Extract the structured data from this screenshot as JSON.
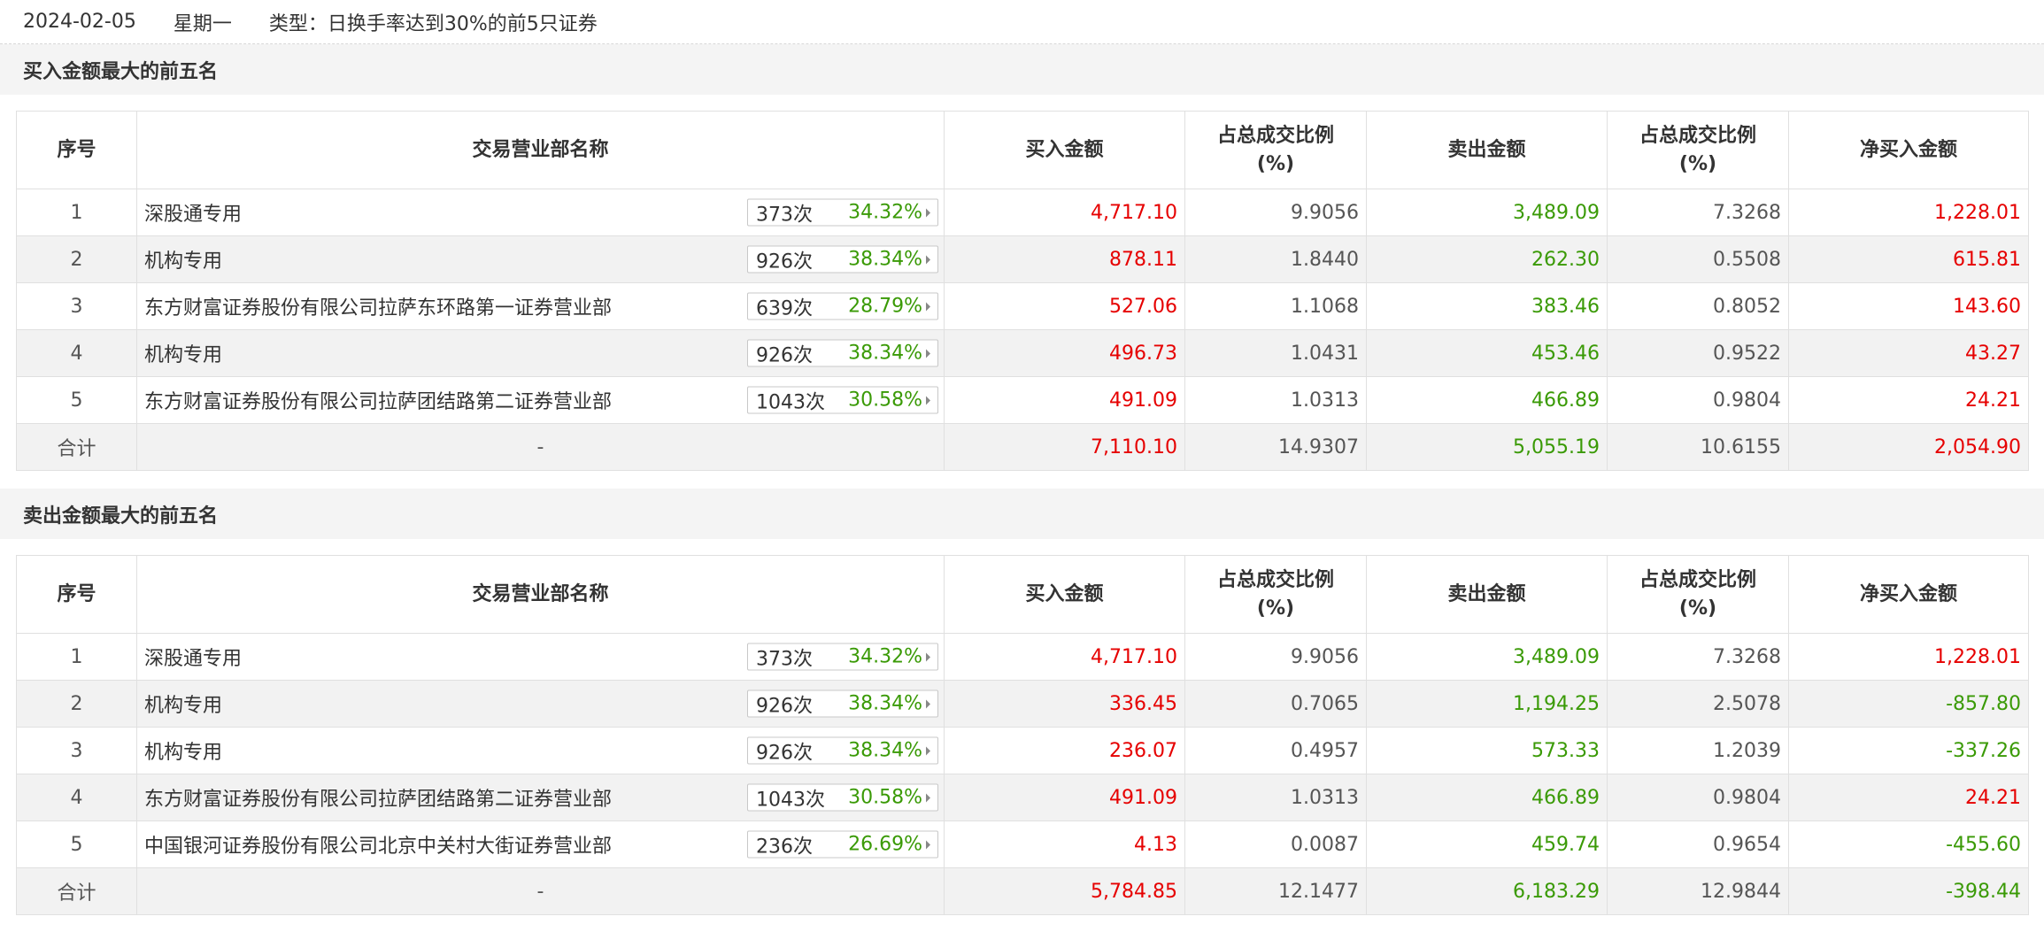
{
  "header": {
    "date": "2024-02-05",
    "weekday": "星期一",
    "type_label": "类型：日换手率达到30%的前5只证券"
  },
  "columns": {
    "seq": "序号",
    "name": "交易营业部名称",
    "buy": "买入金额",
    "buy_ratio_l1": "占总成交比例",
    "buy_ratio_l2": "(%)",
    "sell": "卖出金额",
    "sell_ratio_l1": "占总成交比例",
    "sell_ratio_l2": "(%)",
    "net": "净买入金额"
  },
  "colors": {
    "positive": "#e60000",
    "negative": "#3a9a06"
  },
  "buy_section": {
    "title": "买入金额最大的前五名",
    "rows": [
      {
        "seq": "1",
        "name": "深股通专用",
        "count": "373次",
        "pct": "34.32%",
        "buy": "4,717.10",
        "buy_ratio": "9.9056",
        "sell": "3,489.09",
        "sell_ratio": "7.3268",
        "net": "1,228.01"
      },
      {
        "seq": "2",
        "name": "机构专用",
        "count": "926次",
        "pct": "38.34%",
        "buy": "878.11",
        "buy_ratio": "1.8440",
        "sell": "262.30",
        "sell_ratio": "0.5508",
        "net": "615.81"
      },
      {
        "seq": "3",
        "name": "东方财富证券股份有限公司拉萨东环路第一证券营业部",
        "count": "639次",
        "pct": "28.79%",
        "buy": "527.06",
        "buy_ratio": "1.1068",
        "sell": "383.46",
        "sell_ratio": "0.8052",
        "net": "143.60"
      },
      {
        "seq": "4",
        "name": "机构专用",
        "count": "926次",
        "pct": "38.34%",
        "buy": "496.73",
        "buy_ratio": "1.0431",
        "sell": "453.46",
        "sell_ratio": "0.9522",
        "net": "43.27"
      },
      {
        "seq": "5",
        "name": "东方财富证券股份有限公司拉萨团结路第二证券营业部",
        "count": "1043次",
        "pct": "30.58%",
        "buy": "491.09",
        "buy_ratio": "1.0313",
        "sell": "466.89",
        "sell_ratio": "0.9804",
        "net": "24.21"
      }
    ],
    "total": {
      "label": "合计",
      "name": "-",
      "buy": "7,110.10",
      "buy_ratio": "14.9307",
      "sell": "5,055.19",
      "sell_ratio": "10.6155",
      "net": "2,054.90"
    }
  },
  "sell_section": {
    "title": "卖出金额最大的前五名",
    "rows": [
      {
        "seq": "1",
        "name": "深股通专用",
        "count": "373次",
        "pct": "34.32%",
        "buy": "4,717.10",
        "buy_ratio": "9.9056",
        "sell": "3,489.09",
        "sell_ratio": "7.3268",
        "net": "1,228.01"
      },
      {
        "seq": "2",
        "name": "机构专用",
        "count": "926次",
        "pct": "38.34%",
        "buy": "336.45",
        "buy_ratio": "0.7065",
        "sell": "1,194.25",
        "sell_ratio": "2.5078",
        "net": "-857.80"
      },
      {
        "seq": "3",
        "name": "机构专用",
        "count": "926次",
        "pct": "38.34%",
        "buy": "236.07",
        "buy_ratio": "0.4957",
        "sell": "573.33",
        "sell_ratio": "1.2039",
        "net": "-337.26"
      },
      {
        "seq": "4",
        "name": "东方财富证券股份有限公司拉萨团结路第二证券营业部",
        "count": "1043次",
        "pct": "30.58%",
        "buy": "491.09",
        "buy_ratio": "1.0313",
        "sell": "466.89",
        "sell_ratio": "0.9804",
        "net": "24.21"
      },
      {
        "seq": "5",
        "name": "中国银河证券股份有限公司北京中关村大街证券营业部",
        "count": "236次",
        "pct": "26.69%",
        "buy": "4.13",
        "buy_ratio": "0.0087",
        "sell": "459.74",
        "sell_ratio": "0.9654",
        "net": "-455.60"
      }
    ],
    "total": {
      "label": "合计",
      "name": "-",
      "buy": "5,784.85",
      "buy_ratio": "12.1477",
      "sell": "6,183.29",
      "sell_ratio": "12.9844",
      "net": "-398.44"
    }
  }
}
